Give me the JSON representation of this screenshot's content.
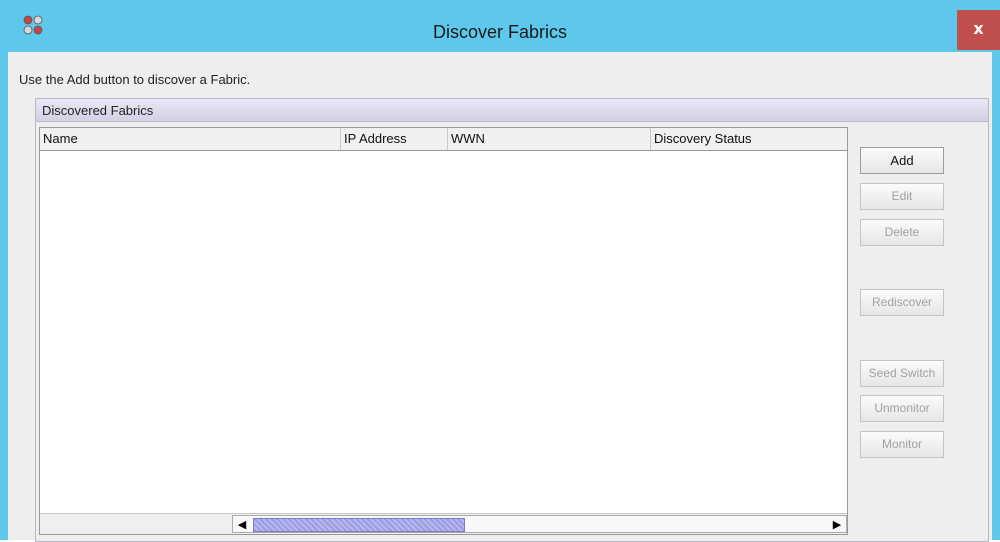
{
  "window": {
    "title": "Discover Fabrics",
    "close_label": "x"
  },
  "instruction": "Use the Add button to discover a Fabric.",
  "group": {
    "title": "Discovered Fabrics",
    "columns": [
      "Name",
      "IP Address",
      "WWN",
      "Discovery Status"
    ],
    "rows": []
  },
  "scrollbar": {
    "left_arrow": "◀",
    "right_arrow": "▶"
  },
  "buttons": {
    "add": "Add",
    "edit": "Edit",
    "delete": "Delete",
    "rediscover": "Rediscover",
    "seed_switch": "Seed Switch",
    "unmonitor": "Unmonitor",
    "monitor": "Monitor"
  },
  "colors": {
    "titlebar": "#5ec8ec",
    "close_button": "#c0504d",
    "scroll_thumb": "#9c9ce0"
  },
  "icons": {
    "app": "app-network-icon",
    "close": "close-icon"
  }
}
